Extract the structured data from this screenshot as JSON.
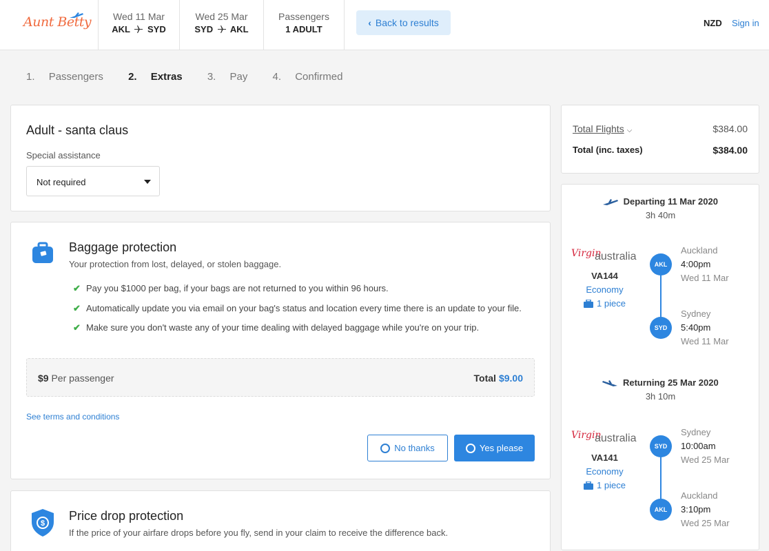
{
  "brand": {
    "name": "Aunt Betty",
    "accent": "#2d86e0",
    "logo_color": "#f06b3f"
  },
  "header": {
    "outbound": {
      "date": "Wed 11 Mar",
      "from": "AKL",
      "to": "SYD"
    },
    "return": {
      "date": "Wed 25 Mar",
      "from": "SYD",
      "to": "AKL"
    },
    "passengers": {
      "label": "Passengers",
      "value": "1 ADULT"
    },
    "back_label": "Back to results",
    "currency": "NZD",
    "sign_in": "Sign in"
  },
  "steps": [
    {
      "num": "1.",
      "label": "Passengers"
    },
    {
      "num": "2.",
      "label": "Extras"
    },
    {
      "num": "3.",
      "label": "Pay"
    },
    {
      "num": "4.",
      "label": "Confirmed"
    }
  ],
  "passenger": {
    "title": "Adult - santa claus",
    "assistance_label": "Special assistance",
    "assistance_value": "Not required"
  },
  "baggage": {
    "title": "Baggage protection",
    "subtitle": "Your protection from lost, delayed, or stolen baggage.",
    "benefits": [
      "Pay you $1000 per bag, if your bags are not returned to you within 96 hours.",
      "Automatically update you via email on your bag's status and location every time there is an update to your file.",
      "Make sure you don't waste any of your time dealing with delayed baggage while you're on your trip."
    ],
    "price": "$9",
    "per_label": "Per passenger",
    "total_label": "Total",
    "total_value": "$9.00",
    "terms": "See terms and conditions",
    "no_label": "No thanks",
    "yes_label": "Yes please"
  },
  "price_drop": {
    "title": "Price drop protection",
    "subtitle": "If the price of your airfare drops before you fly, send in your claim to receive the difference back."
  },
  "summary": {
    "flights_label": "Total Flights",
    "flights_value": "$384.00",
    "total_label": "Total (inc. taxes)",
    "total_value": "$384.00"
  },
  "itinerary": {
    "departing": {
      "title": "Departing 11 Mar 2020",
      "duration": "3h 40m",
      "airline": "australia",
      "flight": "VA144",
      "cabin": "Economy",
      "bags": "1 piece",
      "from": {
        "code": "AKL",
        "city": "Auckland",
        "time": "4:00pm",
        "date": "Wed 11 Mar"
      },
      "to": {
        "code": "SYD",
        "city": "Sydney",
        "time": "5:40pm",
        "date": "Wed 11 Mar"
      }
    },
    "returning": {
      "title": "Returning 25 Mar 2020",
      "duration": "3h 10m",
      "airline": "australia",
      "flight": "VA141",
      "cabin": "Economy",
      "bags": "1 piece",
      "from": {
        "code": "SYD",
        "city": "Sydney",
        "time": "10:00am",
        "date": "Wed 25 Mar"
      },
      "to": {
        "code": "AKL",
        "city": "Auckland",
        "time": "3:10pm",
        "date": "Wed 25 Mar"
      }
    }
  }
}
